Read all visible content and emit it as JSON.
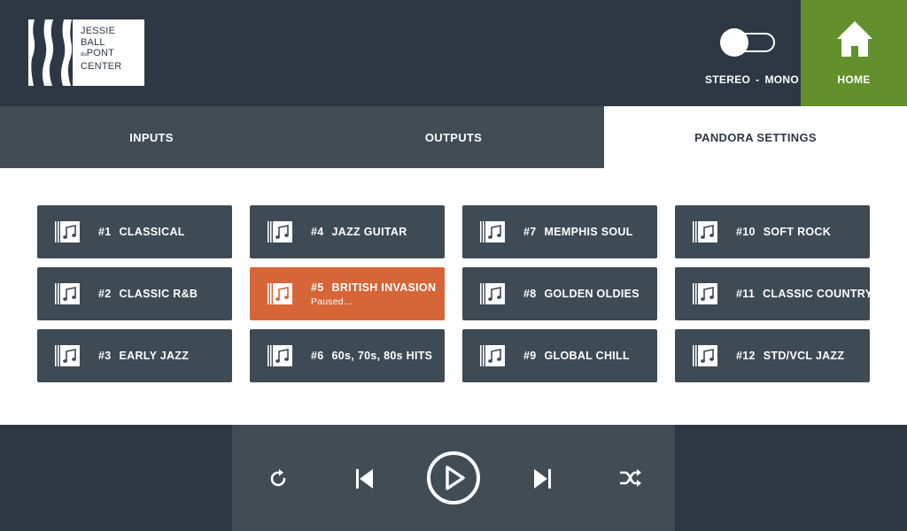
{
  "brand": {
    "logo_lines": [
      "JESSIE",
      "BALL",
      "du",
      "PONT",
      "CENTER"
    ]
  },
  "audio_mode": {
    "left_label": "STEREO",
    "separator": "-",
    "right_label": "MONO",
    "state": "stereo"
  },
  "home": {
    "label": "HOME",
    "icon": "home-icon",
    "color": "#63902c"
  },
  "tabs": [
    {
      "label": "INPUTS",
      "active": false
    },
    {
      "label": "OUTPUTS",
      "active": false
    },
    {
      "label": "PANDORA SETTINGS",
      "active": true
    }
  ],
  "stations": [
    {
      "number": "#1",
      "name": "CLASSICAL",
      "status": ""
    },
    {
      "number": "#2",
      "name": "CLASSIC R&B",
      "status": ""
    },
    {
      "number": "#3",
      "name": "EARLY JAZZ",
      "status": ""
    },
    {
      "number": "#4",
      "name": "JAZZ GUITAR",
      "status": ""
    },
    {
      "number": "#5",
      "name": "BRITISH INVASION",
      "status": "Paused…",
      "active": true
    },
    {
      "number": "#6",
      "name": "60s, 70s, 80s HITS",
      "status": ""
    },
    {
      "number": "#7",
      "name": "MEMPHIS SOUL",
      "status": ""
    },
    {
      "number": "#8",
      "name": "GOLDEN OLDIES",
      "status": ""
    },
    {
      "number": "#9",
      "name": "GLOBAL CHILL",
      "status": ""
    },
    {
      "number": "#10",
      "name": "SOFT ROCK",
      "status": ""
    },
    {
      "number": "#11",
      "name": "CLASSIC COUNTRY",
      "status": ""
    },
    {
      "number": "#12",
      "name": "STD/VCL JAZZ",
      "status": ""
    }
  ],
  "station_icon": "music-note-icon",
  "transport": {
    "controls": [
      "replay-icon",
      "skip-back-icon",
      "play-icon",
      "skip-forward-icon",
      "shuffle-icon"
    ]
  },
  "colors": {
    "header": "#2d3844",
    "tile": "#3e4a54",
    "active_tile": "#d66537",
    "tab_bar": "#414c55"
  }
}
